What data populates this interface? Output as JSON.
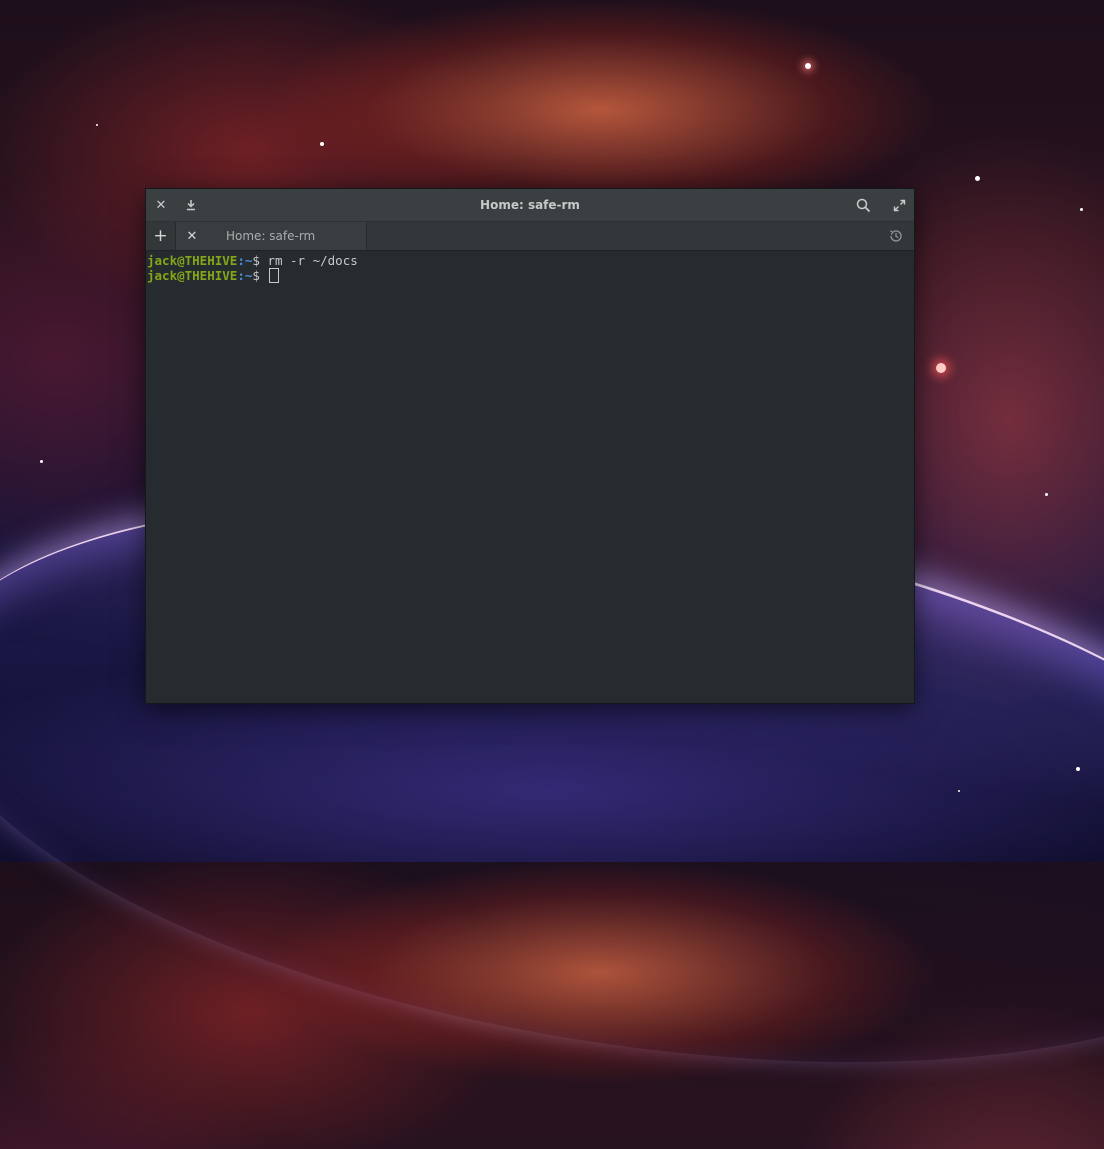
{
  "window": {
    "title": "Home: safe-rm"
  },
  "titlebar": {
    "close_icon": "close-icon",
    "download_icon": "download-icon",
    "search_icon": "search-icon",
    "maximize_icon": "maximize-icon"
  },
  "tabs": [
    {
      "label": "Home: safe-rm",
      "active": true
    }
  ],
  "tabbar": {
    "new_tab_label": "+",
    "history_icon": "history-icon"
  },
  "terminal": {
    "lines": [
      {
        "user": "jack@THEHIVE",
        "sep": ":",
        "path": "~",
        "prompt": "$ ",
        "command": "rm -r ~/docs"
      },
      {
        "user": "jack@THEHIVE",
        "sep": ":",
        "path": "~",
        "prompt": "$ ",
        "command": ""
      }
    ],
    "colors": {
      "user": "#86a61a",
      "path": "#4e8ed8",
      "text": "#c7caca",
      "background": "#252b2e"
    }
  }
}
